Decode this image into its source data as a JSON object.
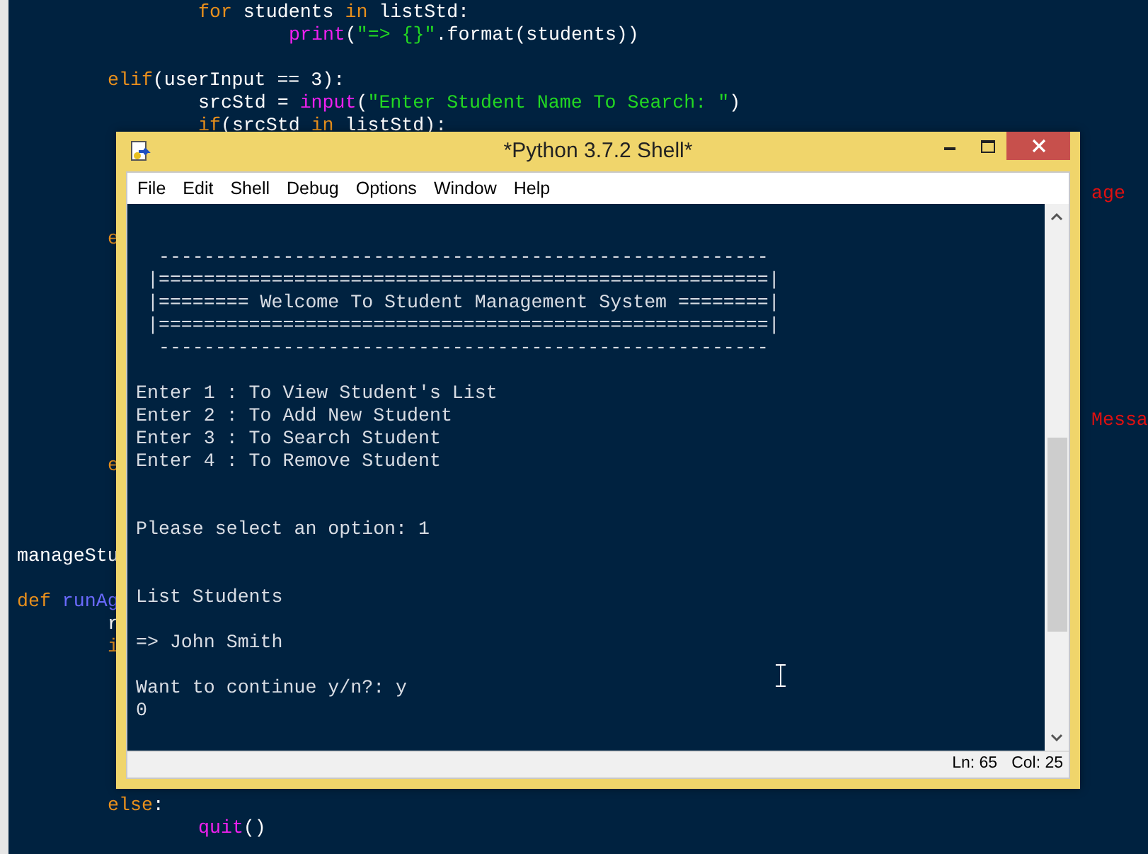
{
  "editor": {
    "lines": [
      {
        "kind": "block",
        "children": [
          {
            "kind": "block",
            "children": [
              {
                "kind": "code",
                "tokens": [
                  {
                    "text": "for",
                    "kind": "keyword"
                  },
                  {
                    "text": " students ",
                    "kind": "plain"
                  },
                  {
                    "text": "in",
                    "kind": "keyword"
                  },
                  {
                    "text": " listStd:",
                    "kind": "plain"
                  }
                ]
              },
              {
                "kind": "block",
                "children": [
                  {
                    "kind": "code",
                    "tokens": [
                      {
                        "text": "print",
                        "kind": "builtin"
                      },
                      {
                        "text": "(",
                        "kind": "plain"
                      },
                      {
                        "text": "\"=> {}\"",
                        "kind": "string"
                      },
                      {
                        "text": ".format(students))",
                        "kind": "plain"
                      }
                    ]
                  }
                ]
              }
            ]
          },
          {
            "kind": "blank"
          },
          {
            "kind": "code",
            "tokens": [
              {
                "text": "elif",
                "kind": "keyword"
              },
              {
                "text": "(userInput == 3):",
                "kind": "plain"
              }
            ]
          },
          {
            "kind": "block",
            "children": [
              {
                "kind": "code",
                "tokens": [
                  {
                    "text": "srcStd = ",
                    "kind": "plain"
                  },
                  {
                    "text": "input",
                    "kind": "builtin"
                  },
                  {
                    "text": "(",
                    "kind": "plain"
                  },
                  {
                    "text": "\"Enter Student Name To Search: \"",
                    "kind": "string"
                  },
                  {
                    "text": ")",
                    "kind": "plain"
                  }
                ]
              },
              {
                "kind": "code",
                "tokens": [
                  {
                    "text": "if",
                    "kind": "keyword"
                  },
                  {
                    "text": "(srcStd ",
                    "kind": "plain"
                  },
                  {
                    "text": "in",
                    "kind": "keyword"
                  },
                  {
                    "text": " listStd):",
                    "kind": "plain"
                  }
                ]
              }
            ]
          },
          {
            "kind": "blank"
          },
          {
            "kind": "blank"
          }
        ]
      },
      {
        "kind": "right",
        "tokens": [
          {
            "text": "age",
            "kind": "error"
          }
        ]
      },
      {
        "kind": "block",
        "children": [
          {
            "kind": "blank"
          },
          {
            "kind": "code",
            "tokens": [
              {
                "text": "e",
                "kind": "keyword"
              }
            ]
          },
          {
            "kind": "blank"
          },
          {
            "kind": "blank"
          },
          {
            "kind": "blank"
          },
          {
            "kind": "blank"
          },
          {
            "kind": "blank"
          },
          {
            "kind": "blank"
          },
          {
            "kind": "blank"
          }
        ]
      },
      {
        "kind": "right",
        "tokens": [
          {
            "text": "Messa",
            "kind": "error"
          }
        ]
      },
      {
        "kind": "block",
        "children": [
          {
            "kind": "blank"
          },
          {
            "kind": "code",
            "tokens": [
              {
                "text": "e",
                "kind": "keyword"
              }
            ]
          }
        ]
      },
      {
        "kind": "blank"
      },
      {
        "kind": "blank"
      },
      {
        "kind": "blank"
      },
      {
        "kind": "code",
        "tokens": [
          {
            "text": "manageStu",
            "kind": "plain"
          }
        ]
      },
      {
        "kind": "blank"
      },
      {
        "kind": "code",
        "tokens": [
          {
            "text": "def ",
            "kind": "keyword"
          },
          {
            "text": "runAg",
            "kind": "defname"
          }
        ]
      },
      {
        "kind": "block",
        "children": [
          {
            "kind": "code",
            "tokens": [
              {
                "text": "r",
                "kind": "plain"
              }
            ]
          },
          {
            "kind": "code",
            "tokens": [
              {
                "text": "i",
                "kind": "keyword"
              }
            ]
          },
          {
            "kind": "blank"
          },
          {
            "kind": "blank"
          },
          {
            "kind": "blank"
          },
          {
            "kind": "blank"
          },
          {
            "kind": "blank"
          },
          {
            "kind": "blank"
          },
          {
            "kind": "code",
            "tokens": [
              {
                "text": "else",
                "kind": "keyword"
              },
              {
                "text": ":",
                "kind": "plain"
              }
            ]
          },
          {
            "kind": "block",
            "children": [
              {
                "kind": "code",
                "tokens": [
                  {
                    "text": "quit",
                    "kind": "builtin"
                  },
                  {
                    "text": "()",
                    "kind": "plain"
                  }
                ]
              }
            ]
          }
        ]
      }
    ]
  },
  "window": {
    "title": "*Python 3.7.2 Shell*",
    "menu": [
      "File",
      "Edit",
      "Shell",
      "Debug",
      "Options",
      "Window",
      "Help"
    ],
    "shell_lines": [
      {
        "kind": "text",
        "text": "  ------------------------------------------------------"
      },
      {
        "kind": "text",
        "text": " |======================================================|"
      },
      {
        "kind": "text",
        "text": " |======== Welcome To Student Management System ========|"
      },
      {
        "kind": "text",
        "text": " |======================================================|"
      },
      {
        "kind": "text",
        "text": "  ------------------------------------------------------"
      },
      {
        "kind": "blank"
      },
      {
        "kind": "text",
        "text": "Enter 1 : To View Student's List"
      },
      {
        "kind": "text",
        "text": "Enter 2 : To Add New Student"
      },
      {
        "kind": "text",
        "text": "Enter 3 : To Search Student"
      },
      {
        "kind": "text",
        "text": "Enter 4 : To Remove Student"
      },
      {
        "kind": "blank"
      },
      {
        "kind": "blank"
      },
      {
        "kind": "text",
        "text": "Please select an option: 1"
      },
      {
        "kind": "blank"
      },
      {
        "kind": "blank"
      },
      {
        "kind": "text",
        "text": "List Students"
      },
      {
        "kind": "blank"
      },
      {
        "kind": "text",
        "text": "=> John Smith"
      },
      {
        "kind": "blank"
      },
      {
        "kind": "text",
        "text": "Want to continue y/n?: y"
      },
      {
        "kind": "text",
        "text": "0"
      }
    ],
    "status": {
      "line": "Ln: 65",
      "column": "Col: 25"
    }
  }
}
